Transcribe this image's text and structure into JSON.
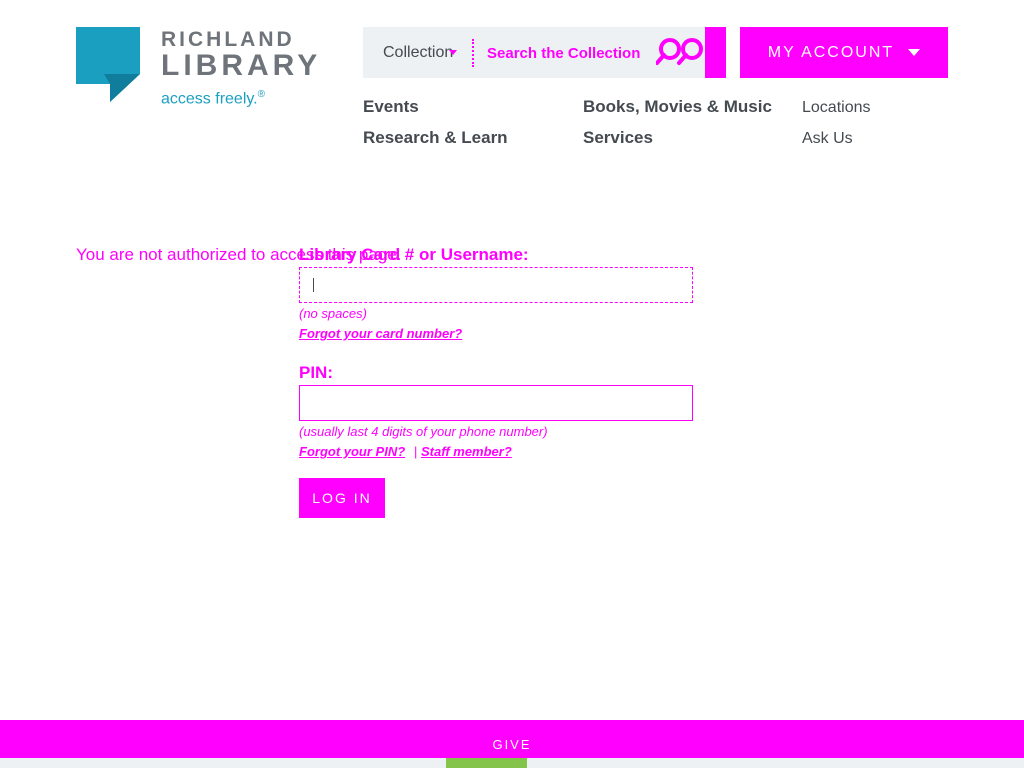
{
  "logo": {
    "line1": "RICHLAND",
    "line2": "LIBRARY",
    "tagline": "access freely.",
    "registered": "®",
    "icon": "library-logo-icon",
    "colors": {
      "mark": "#1a9fc0",
      "mark_dark": "#0f7d9b",
      "text": "#6e7479",
      "tagline": "#1a9fc0"
    }
  },
  "search": {
    "scope_label": "Collection",
    "placeholder": "Search the Collection",
    "icon": "search-icon"
  },
  "account": {
    "label": "MY ACCOUNT",
    "icon": "caret-down-icon"
  },
  "nav": {
    "events": "Events",
    "research": "Research & Learn",
    "books": "Books, Movies & Music",
    "services": "Services",
    "locations": "Locations",
    "ask_us": "Ask Us"
  },
  "message": {
    "not_authorized": "You are not authorized to access this page."
  },
  "login": {
    "card_label": "Library Card # or Username:",
    "card_value": "",
    "card_hint": "(no spaces)",
    "forgot_card": "Forgot your card number?",
    "pin_label": "PIN:",
    "pin_value": "",
    "pin_hint": "(usually last 4 digits of your phone number)",
    "forgot_pin": "Forgot your PIN?",
    "separator": "|",
    "staff": "Staff member?",
    "button": "LOG IN"
  },
  "footer": {
    "give": "GIVE"
  },
  "colors": {
    "accent": "#ff00ff",
    "nav_text": "#444a50",
    "search_bg": "#eef1f4",
    "give_accent": "#84c44a"
  }
}
